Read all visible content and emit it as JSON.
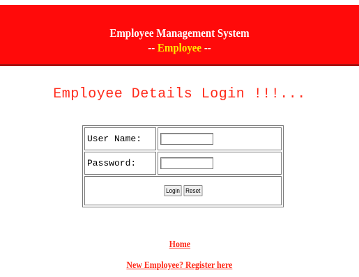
{
  "header": {
    "title": "Employee Management System",
    "subtitle_prefix": "-- ",
    "subtitle": "Employee",
    "subtitle_suffix": " --"
  },
  "heading": "Employee Details Login !!!...",
  "form": {
    "username_label": "User Name:",
    "username_value": "",
    "password_label": "Password:",
    "password_value": "",
    "login_label": "Login",
    "reset_label": "Reset"
  },
  "links": {
    "home": "Home",
    "register": "New Employee? Register here"
  },
  "colors": {
    "banner": "#ff0a0a",
    "title": "#ffffff",
    "subtitle": "#ffea00",
    "heading": "#ff2a1a",
    "links": "#ff2a1a"
  }
}
